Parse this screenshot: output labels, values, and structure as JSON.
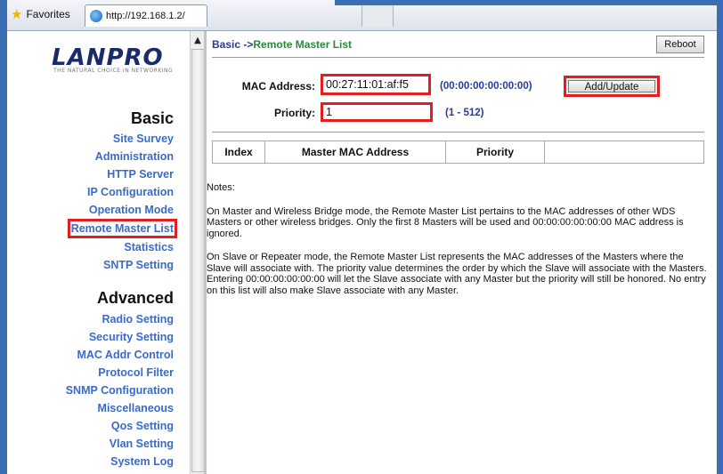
{
  "browser": {
    "favorites_label": "Favorites",
    "tab_url": "http://192.168.1.2/"
  },
  "nav": {
    "logo": "LANPRO",
    "logo_tagline": "THE NATURAL CHOICE IN NETWORKING",
    "basic_heading": "Basic",
    "basic_items": [
      "Site Survey",
      "Administration",
      "HTTP Server",
      "IP Configuration",
      "Operation Mode",
      "Remote Master List",
      "Statistics",
      "SNTP Setting"
    ],
    "advanced_heading": "Advanced",
    "advanced_items": [
      "Radio Setting",
      "Security Setting",
      "MAC Addr Control",
      "Protocol Filter",
      "SNMP Configuration",
      "Miscellaneous",
      "Qos Setting",
      "Vlan Setting",
      "System Log"
    ]
  },
  "page": {
    "crumb_prefix": "Basic ->",
    "crumb_current": "Remote Master List",
    "reboot_label": "Reboot",
    "mac_label": "MAC Address:",
    "mac_value": "00:27:11:01:af:f5",
    "mac_hint": "(00:00:00:00:00:00)",
    "priority_label": "Priority:",
    "priority_value": "1",
    "priority_hint": "(1 - 512)",
    "add_update_label": "Add/Update",
    "table_headers": [
      "Index",
      "Master MAC Address",
      "Priority",
      ""
    ],
    "notes_title": "Notes:",
    "note1": "On Master and Wireless Bridge mode, the Remote Master List pertains to the MAC addresses of other WDS Masters or other wireless bridges. Only the first 8 Masters will be used and 00:00:00:00:00:00 MAC address is ignored.",
    "note2": "On Slave or Repeater mode, the Remote Master List represents the MAC addresses of the Masters where the Slave will associate with. The priority value determines the order by which the Slave will associate with the Masters. Entering 00:00:00:00:00:00 will let the Slave associate with any Master but the priority will still be honored. No entry on this list will also make Slave associate with any Master."
  },
  "colors": {
    "frame_blue": "#3a6fb5",
    "nav_link": "#3a6bc8",
    "highlight_red": "#e02020"
  }
}
